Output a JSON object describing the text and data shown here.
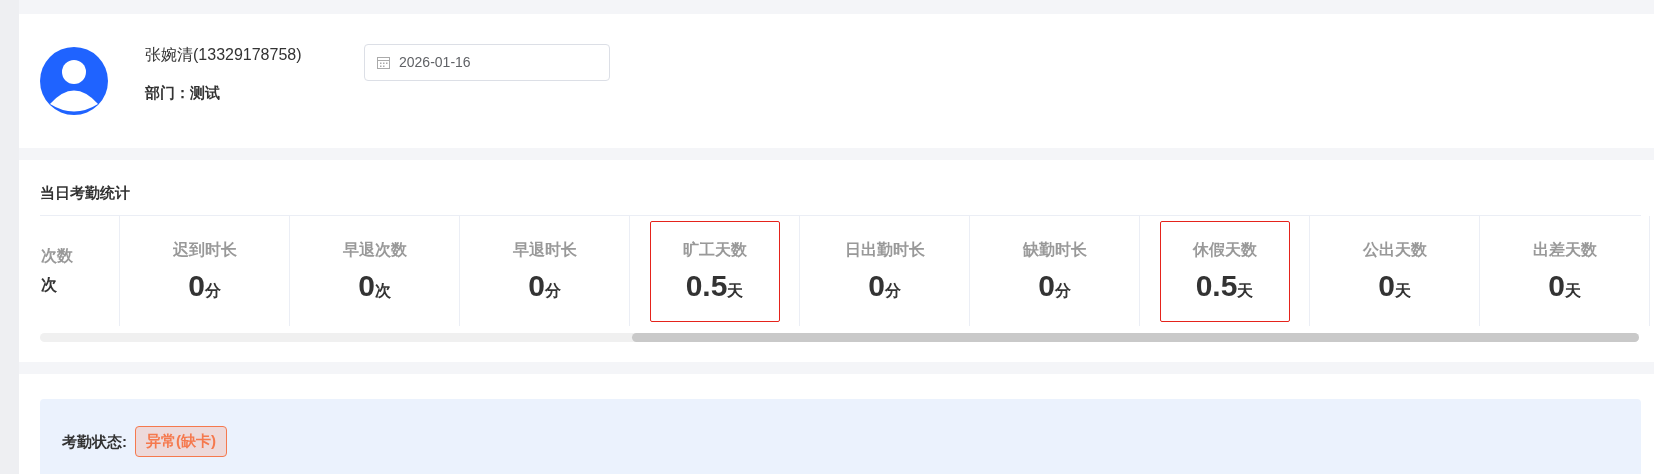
{
  "profile": {
    "name": "张婉清(13329178758)",
    "department_label": "部门：",
    "department": "测试",
    "date": "2026-01-16"
  },
  "stats": {
    "title": "当日考勤统计",
    "cells": [
      {
        "label": "次数",
        "unit": "次",
        "highlighted": false
      },
      {
        "label": "迟到时长",
        "value": "0",
        "unit": "分",
        "highlighted": false
      },
      {
        "label": "早退次数",
        "value": "0",
        "unit": "次",
        "highlighted": false
      },
      {
        "label": "早退时长",
        "value": "0",
        "unit": "分",
        "highlighted": false
      },
      {
        "label": "旷工天数",
        "value": "0.5",
        "unit": "天",
        "highlighted": true
      },
      {
        "label": "日出勤时长",
        "value": "0",
        "unit": "分",
        "highlighted": false
      },
      {
        "label": "缺勤时长",
        "value": "0",
        "unit": "分",
        "highlighted": false
      },
      {
        "label": "休假天数",
        "value": "0.5",
        "unit": "天",
        "highlighted": true
      },
      {
        "label": "公出天数",
        "value": "0",
        "unit": "天",
        "highlighted": false
      },
      {
        "label": "出差天数",
        "value": "0",
        "unit": "天",
        "highlighted": false
      }
    ]
  },
  "status": {
    "label": "考勤状态:",
    "badge": "异常(缺卡)",
    "color": "#f5794e"
  }
}
